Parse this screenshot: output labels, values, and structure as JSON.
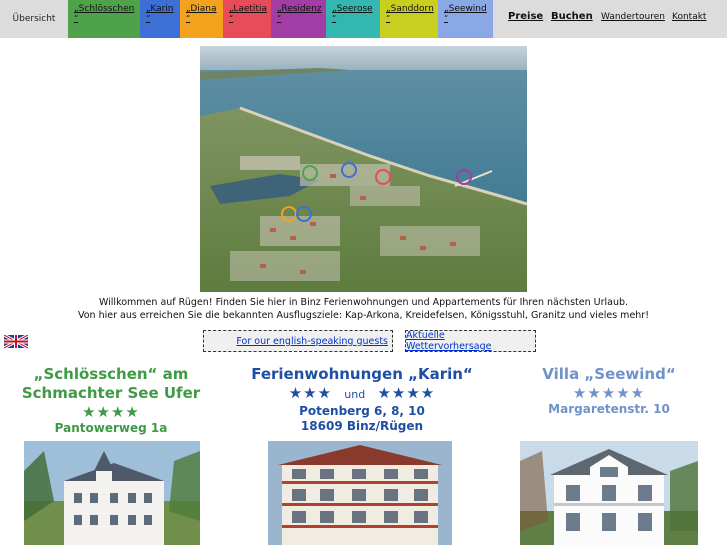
{
  "nav": {
    "home": "Übersicht",
    "tabs": [
      {
        "label": "„Schlösschen",
        "under": "“",
        "color": "#4ea34a"
      },
      {
        "label": "„Karin",
        "under": "“",
        "color": "#3e6fd6"
      },
      {
        "label": "„Diana",
        "under": "“",
        "color": "#f2a21c"
      },
      {
        "label": "„Laetitia",
        "under": "“",
        "color": "#e84b5a"
      },
      {
        "label": "„Residenz",
        "under": "“",
        "color": "#a13da5"
      },
      {
        "label": "„Seerose",
        "under": "“",
        "color": "#34b7b0"
      },
      {
        "label": "„Sanddorn",
        "under": "“",
        "color": "#c8cf1f"
      },
      {
        "label": "„Seewind",
        "under": "“",
        "color": "#8aa7e6"
      }
    ],
    "preise": "Preise",
    "buchen": "Buchen",
    "wandertouren": "Wandertouren",
    "kontakt": "Kontakt"
  },
  "intro": {
    "line1": "Willkommen auf Rügen! Finden Sie hier in Binz Ferienwohnungen und Appartements für Ihren nächsten Urlaub.",
    "line2": "Von hier aus erreichen Sie die bekannten Ausflugsziele: Kap-Arkona, Kreidefelsen, Königsstuhl, Granitz und vieles mehr!"
  },
  "links": {
    "english": "For our english-speaking guests",
    "weather": "Aktuelle Wettervorhersage"
  },
  "houses": {
    "schloesschen": {
      "title1": "„Schlösschen“ am",
      "title2": "Schmachter See Ufer",
      "stars": "★★★★",
      "address": "Pantowerweg 1a"
    },
    "karin": {
      "title": "Ferienwohnungen „Karin“",
      "stars_a": "★★★",
      "und": "und",
      "stars_b": "★★★★",
      "address1": "Potenberg 6, 8, 10",
      "address2": "18609 Binz/Rügen"
    },
    "seewind": {
      "title": "Villa „Seewind“",
      "stars": "★★★★★",
      "address": "Margaretenstr. 10"
    }
  },
  "colors": {
    "nav_bg": "#dcdcdc",
    "green": "#3f9a45",
    "blue": "#1f4fa5",
    "light_blue": "#6f93c9"
  }
}
